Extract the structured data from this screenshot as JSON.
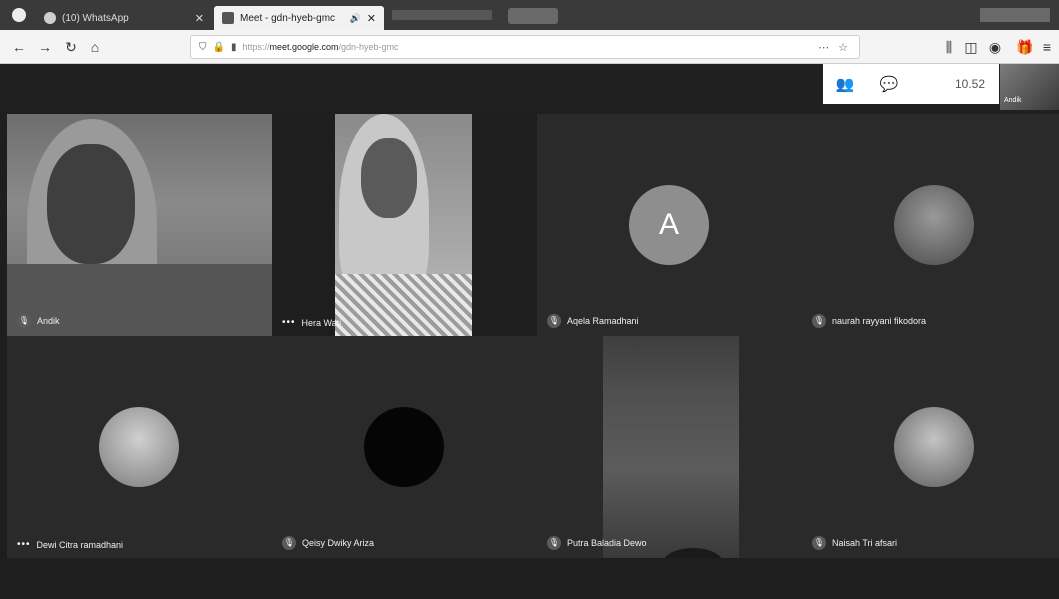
{
  "browser": {
    "tabs": [
      {
        "label": "(10) WhatsApp",
        "icon": "whatsapp-icon"
      },
      {
        "label": "Meet - gdn-hyeb-gmc",
        "icon": "meet-icon",
        "audio": "🔊"
      }
    ],
    "url": {
      "prefix": "https://",
      "host": "meet.google.com",
      "path": "/gdn-hyeb-gmc"
    }
  },
  "meet": {
    "time": "10.52",
    "self_name": "Andik",
    "participants": [
      {
        "name": "Andik",
        "type": "video",
        "indicator": "mic"
      },
      {
        "name": "Hera Wati",
        "type": "video",
        "indicator": "dots"
      },
      {
        "name": "Aqela Ramadhani",
        "type": "letter",
        "letter": "A",
        "indicator": "mic"
      },
      {
        "name": "naurah rayyani fikodora",
        "type": "avatar",
        "indicator": "mic"
      },
      {
        "name": "Dewi Citra ramadhani",
        "type": "avatar",
        "indicator": "dots"
      },
      {
        "name": "Qeisy Dwiky Ariza",
        "type": "avatar-dark",
        "indicator": "mic"
      },
      {
        "name": "Putra Baladia Dewo",
        "type": "video",
        "indicator": "mic"
      },
      {
        "name": "Naisah Tri afsari",
        "type": "avatar",
        "indicator": "mic"
      }
    ]
  }
}
